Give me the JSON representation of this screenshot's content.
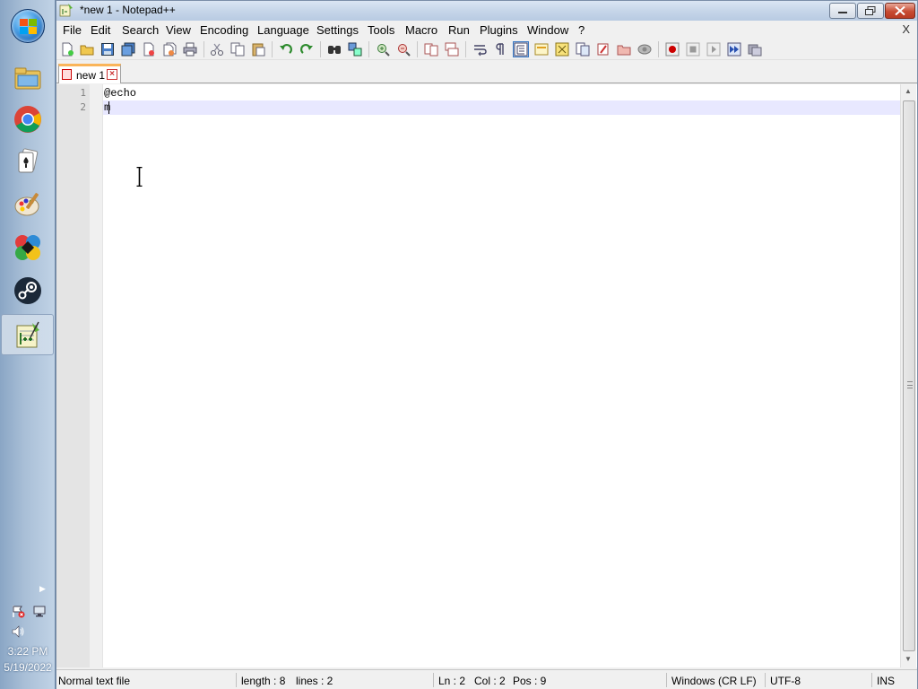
{
  "taskbar": {
    "clock_time": "3:22 PM",
    "clock_date": "5/19/2022",
    "items": [
      {
        "name": "file-explorer-icon"
      },
      {
        "name": "chrome-icon"
      },
      {
        "name": "solitaire-icon"
      },
      {
        "name": "paint-icon"
      },
      {
        "name": "pinwheel-app-icon"
      },
      {
        "name": "steam-icon"
      },
      {
        "name": "notepadpp-icon"
      }
    ]
  },
  "window": {
    "title": "*new 1 - Notepad++"
  },
  "menu": {
    "items": [
      "File",
      "Edit",
      "Search",
      "View",
      "Encoding",
      "Language",
      "Settings",
      "Tools",
      "Macro",
      "Run",
      "Plugins",
      "Window",
      "?"
    ],
    "close_label": "X"
  },
  "tabs": [
    {
      "label": "new 1"
    }
  ],
  "editor": {
    "lines": [
      {
        "number": "1",
        "text": "@echo"
      },
      {
        "number": "2",
        "text": "m"
      }
    ]
  },
  "status": {
    "file_type": "Normal text file",
    "length": "length : 8",
    "lines": "lines : 2",
    "ln": "Ln : 2",
    "col": "Col : 2",
    "pos": "Pos : 9",
    "eol": "Windows (CR LF)",
    "encoding": "UTF-8",
    "mode": "INS"
  },
  "colors": {
    "tab_accent": "#fab55a",
    "current_line": "#e8e8ff",
    "gutter": "#e4e4e4"
  }
}
